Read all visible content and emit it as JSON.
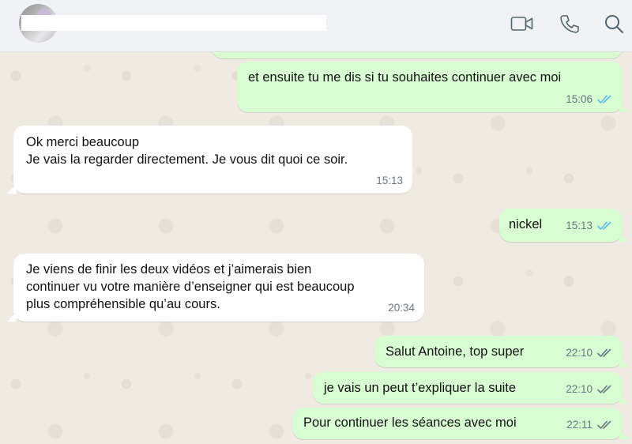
{
  "header": {
    "contact_name": "",
    "icons": [
      "video-call-icon",
      "voice-call-icon",
      "search-icon"
    ]
  },
  "colors": {
    "outgoing_bubble": "#d9fdd3",
    "incoming_bubble": "#ffffff",
    "read_ticks": "#53bdeb",
    "delivered_ticks": "#667781",
    "chat_background": "#efeae2"
  },
  "messages": [
    {
      "direction": "out",
      "text": "et ensuite tu me dis si tu souhaites continuer avec moi",
      "time": "15:06",
      "status": "read"
    },
    {
      "direction": "in",
      "text": "Ok merci beaucoup\nJe vais la regarder directement. Je vous dit quoi ce soir.",
      "time": "15:13"
    },
    {
      "direction": "out",
      "text": "nickel",
      "time": "15:13",
      "status": "read"
    },
    {
      "direction": "in",
      "text": "Je viens de finir les deux vidéos et j’aimerais bien\ncontinuer vu votre manière d’enseigner qui est beaucoup\nplus compréhensible qu’au cours.",
      "time": "20:34"
    },
    {
      "direction": "out",
      "text": "Salut Antoine, top super",
      "time": "22:10",
      "status": "delivered"
    },
    {
      "direction": "out",
      "text": "je vais un peut t’expliquer la suite",
      "time": "22:10",
      "status": "delivered"
    },
    {
      "direction": "out",
      "text": "Pour continuer les séances avec moi",
      "time": "22:11",
      "status": "delivered"
    }
  ]
}
